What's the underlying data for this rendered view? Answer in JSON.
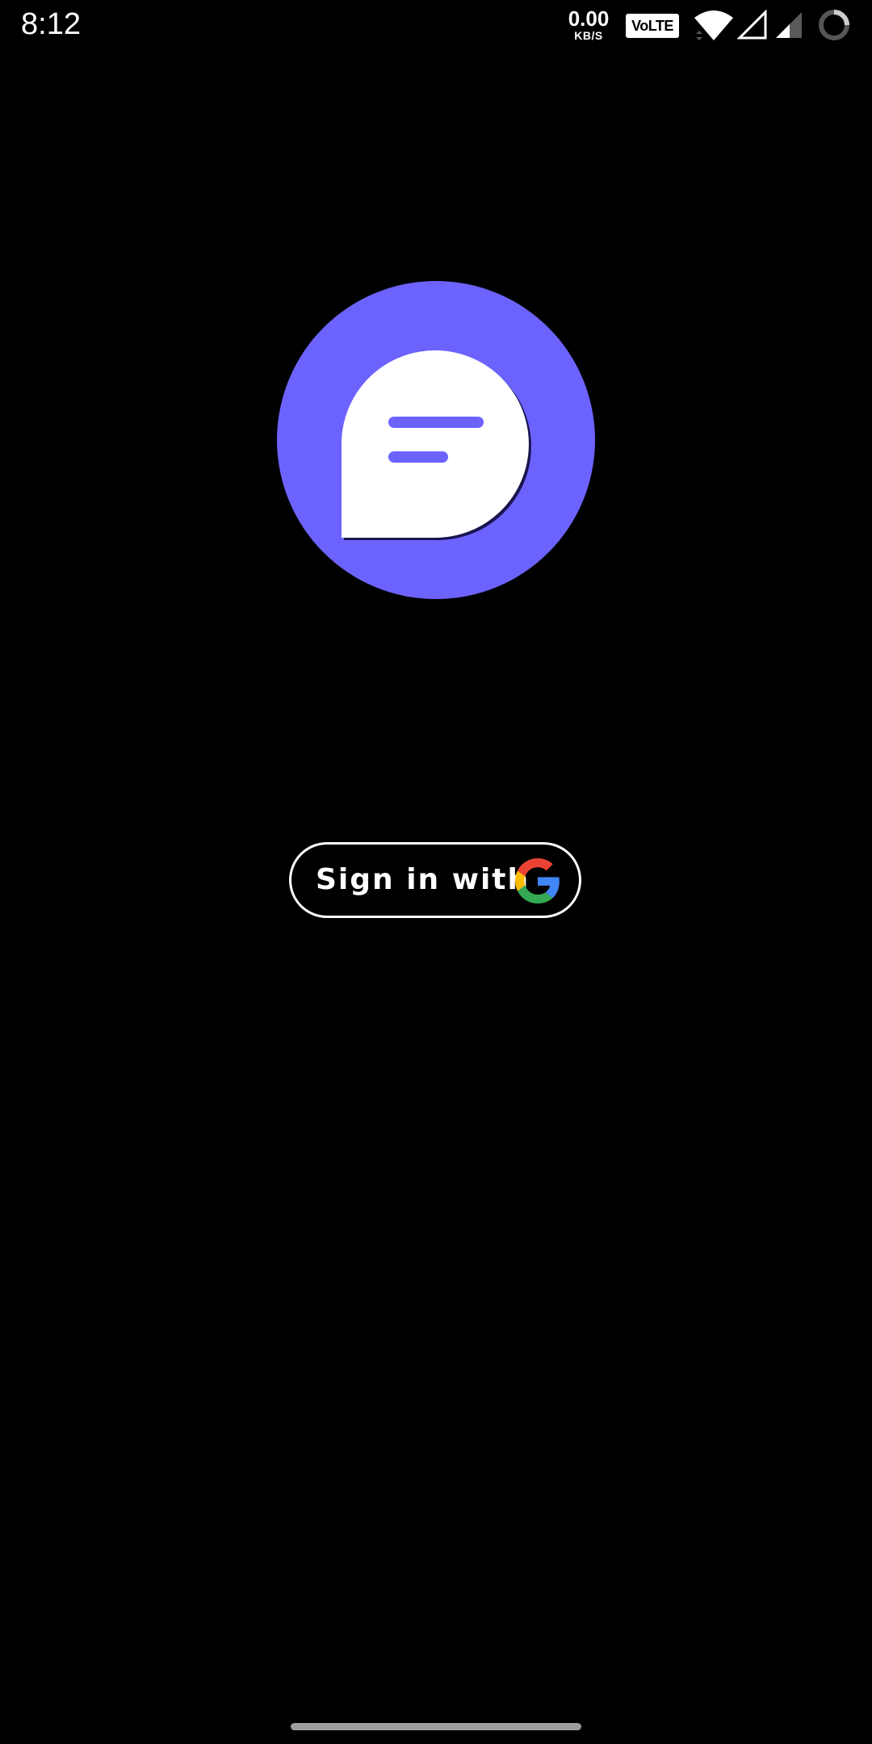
{
  "status_bar": {
    "time": "8:12",
    "net_speed_value": "0.00",
    "net_speed_unit": "KB/S",
    "volte_label": "VoLTE",
    "icons": [
      "wifi-icon",
      "signal-empty-icon",
      "signal-partial-icon",
      "loading-ring-icon"
    ]
  },
  "logo": {
    "icon": "chat-bubble-icon",
    "circle_color": "#6c63ff",
    "bubble_color": "#ffffff"
  },
  "signin": {
    "label": "Sign in with",
    "icon": "google-icon",
    "google_colors": {
      "red": "#ea4335",
      "yellow": "#fbbc05",
      "green": "#34a853",
      "blue": "#4285f4"
    }
  },
  "nav": {
    "handle": "gesture-handle"
  }
}
